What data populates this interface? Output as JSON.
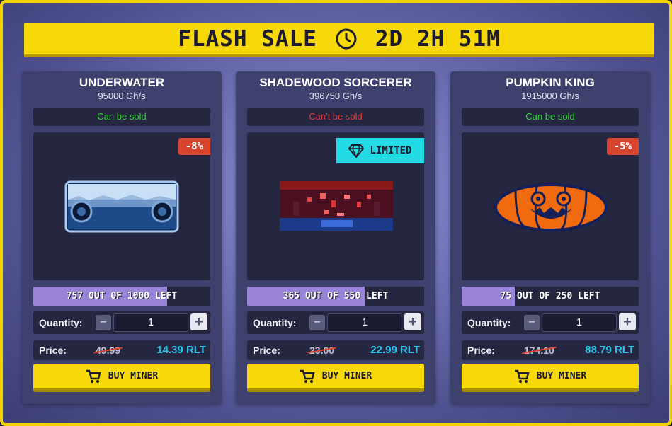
{
  "banner": {
    "title": "FLASH SALE",
    "countdown": "2D 2H 51M",
    "clock_icon": "clock-icon"
  },
  "colors": {
    "accent_yellow": "#f7d90a",
    "can_sell": "#35d23a",
    "cant_sell": "#e03b3b",
    "price_rlt": "#28c6ea",
    "discount_badge": "#d8442e",
    "limited_badge": "#22dbe4",
    "stock_fill": "#9a84d8"
  },
  "cards": [
    {
      "name": "UNDERWATER",
      "power": "95000 Gh/s",
      "sell_status": "Can be sold",
      "discount": "-8%",
      "stock_text": "757 OUT OF 1000 LEFT",
      "stock_fraction": 0.757,
      "quantity_label": "Quantity:",
      "quantity": "1",
      "price_label": "Price:",
      "old_price": "49.99",
      "new_price": "14.39 RLT",
      "buy_label": "BUY MINER"
    },
    {
      "name": "SHADEWOOD SORCERER",
      "power": "396750 Gh/s",
      "sell_status": "Can't be sold",
      "badge": "LIMITED",
      "stock_text": "365 OUT OF 550 LEFT",
      "stock_fraction": 0.6636,
      "quantity_label": "Quantity:",
      "quantity": "1",
      "price_label": "Price:",
      "old_price": "23.00",
      "new_price": "22.99 RLT",
      "buy_label": "BUY MINER"
    },
    {
      "name": "PUMPKIN KING",
      "power": "1915000 Gh/s",
      "sell_status": "Can be sold",
      "discount": "-5%",
      "stock_text": "75 OUT OF 250 LEFT",
      "stock_fraction": 0.3,
      "quantity_label": "Quantity:",
      "quantity": "1",
      "price_label": "Price:",
      "old_price": "174.10",
      "new_price": "88.79 RLT",
      "buy_label": "BUY MINER"
    }
  ]
}
